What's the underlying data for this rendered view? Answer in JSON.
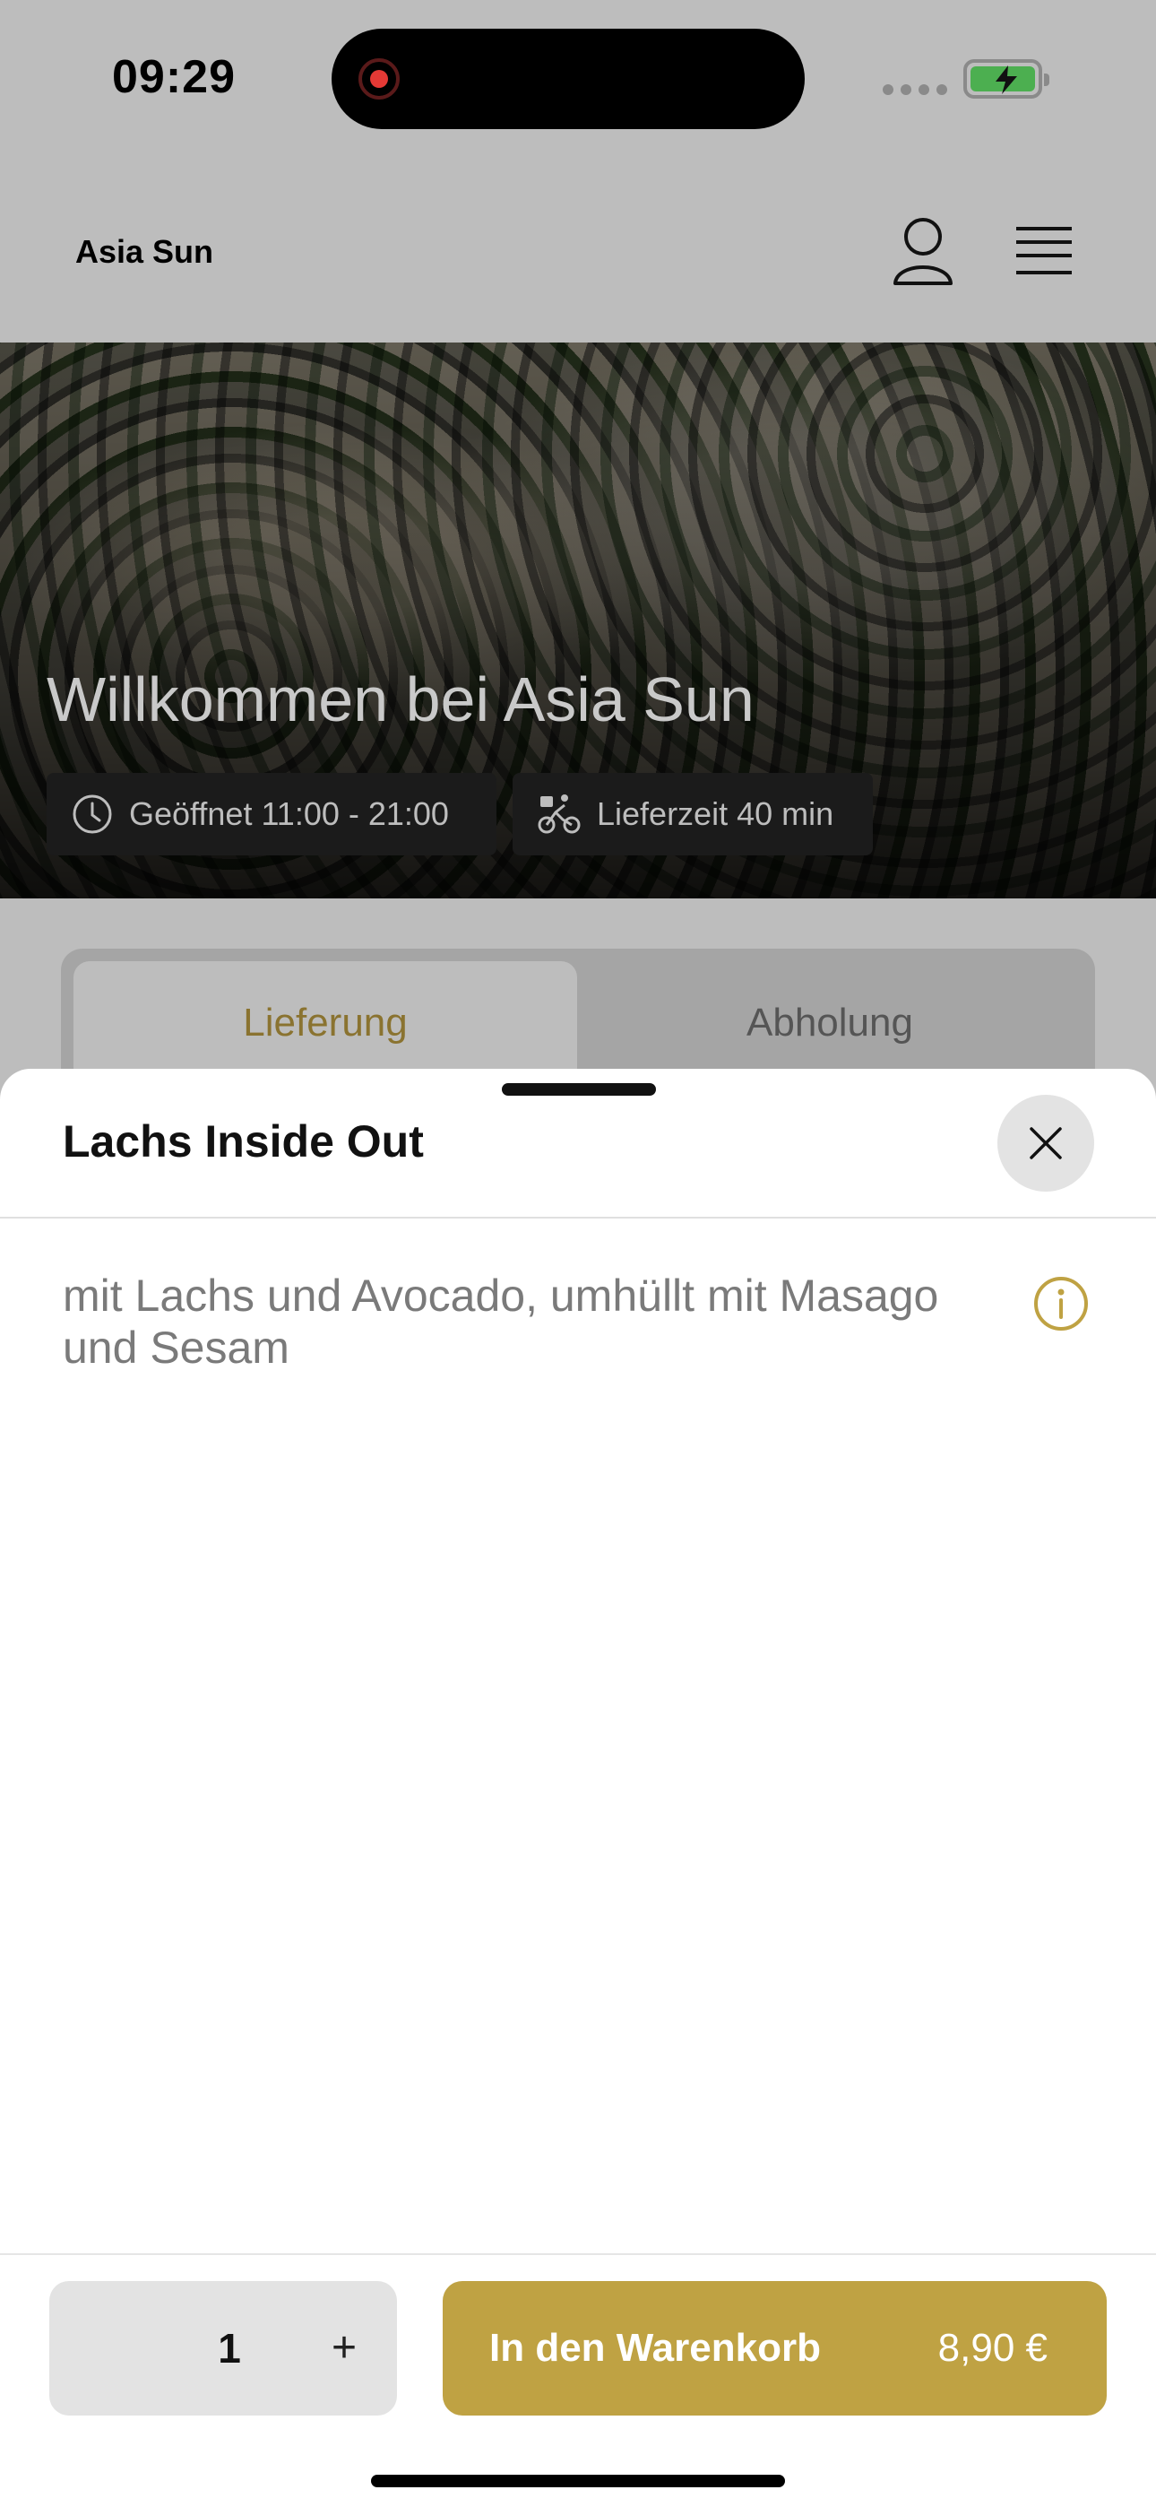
{
  "status_bar": {
    "time": "09:29"
  },
  "header": {
    "brand": "Asia Sun"
  },
  "hero": {
    "title": "Willkommen bei Asia Sun",
    "open_hours": "Geöffnet 11:00 - 21:00",
    "delivery_time": "Lieferzeit 40 min"
  },
  "mode_tabs": {
    "delivery": "Lieferung",
    "pickup": "Abholung",
    "selected": "Lieferung"
  },
  "sheet": {
    "title": "Lachs Inside Out",
    "description": "mit Lachs und Avocado, umhüllt mit Masago und Sesam",
    "quantity": "1",
    "plus_label": "+",
    "add_to_cart_label": "In den Warenkorb",
    "price": "8,90 €"
  },
  "colors": {
    "accent": "#bfa243",
    "overlay_dim": "#bdbdbd",
    "sheet_background": "#ffffff",
    "battery_fill": "#4caf50"
  },
  "icons": [
    "record-icon",
    "battery-charging-icon",
    "user-icon",
    "menu-icon",
    "clock-icon",
    "bike-icon",
    "close-icon",
    "info-icon"
  ]
}
